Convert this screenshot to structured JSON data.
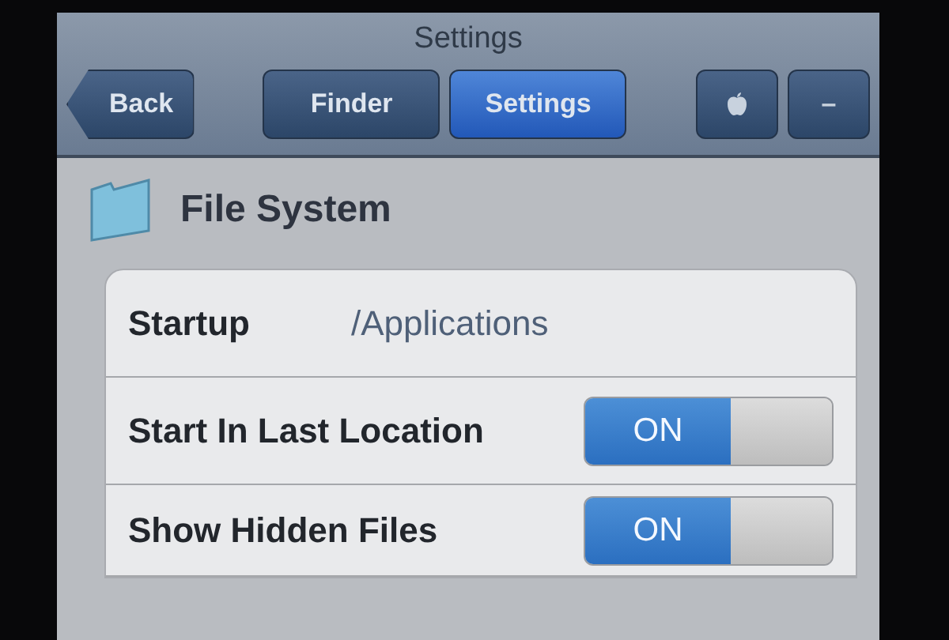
{
  "nav_bar": {
    "title": "Settings",
    "back": {
      "label": "Back"
    },
    "tabs": [
      {
        "label": "Finder",
        "selected": false
      },
      {
        "label": "Settings",
        "selected": true
      }
    ],
    "tools": [
      {
        "kind": "apple"
      },
      {
        "kind": "text",
        "label": "–"
      }
    ]
  },
  "section": {
    "title": "File System"
  },
  "rows": [
    {
      "kind": "value",
      "label": "Startup",
      "value": "/Applications"
    },
    {
      "kind": "switch",
      "label": "Start In Last Location",
      "on": true,
      "switch_label": "ON"
    },
    {
      "kind": "switch",
      "label": "Show Hidden Files",
      "on": true,
      "switch_label": "ON"
    }
  ]
}
